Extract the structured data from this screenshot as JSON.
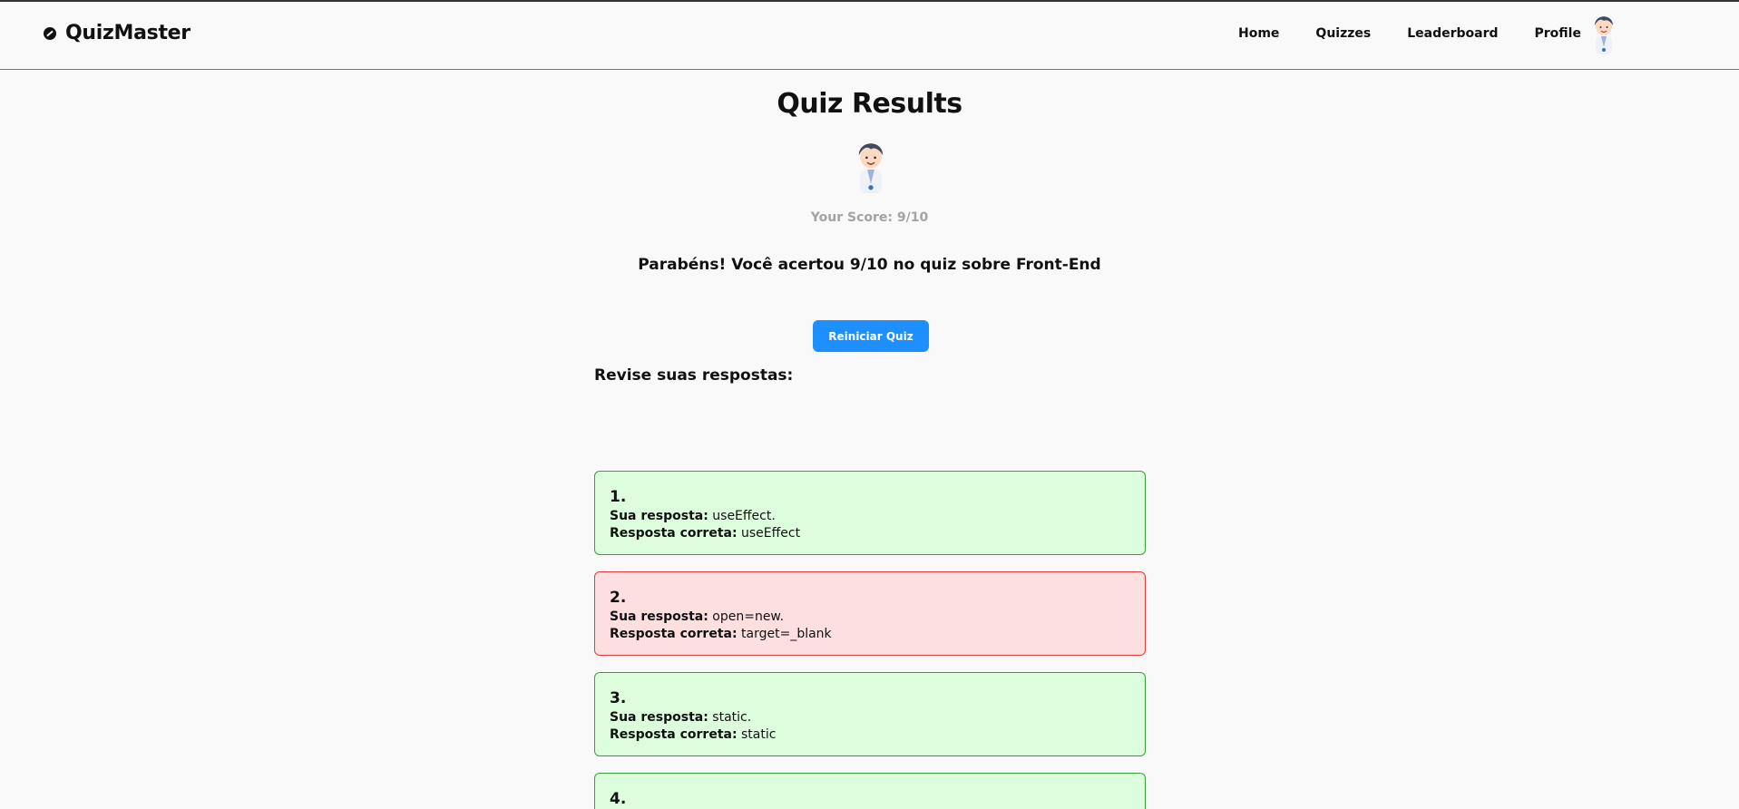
{
  "navbar": {
    "brand": "QuizMaster",
    "links": [
      "Home",
      "Quizzes",
      "Leaderboard",
      "Profile"
    ]
  },
  "results": {
    "title": "Quiz Results",
    "score_text": "Your Score: 9/10",
    "message": "Parabéns! Você acertou 9/10 no quiz sobre Front-End",
    "restart_label": "Reiniciar Quiz",
    "review_heading": "Revise suas respostas:"
  },
  "labels": {
    "your_answer": "Sua resposta:",
    "correct_answer": "Resposta correta:"
  },
  "answers": [
    {
      "number": "1.",
      "your_answer": "useEffect.",
      "correct_answer": "useEffect",
      "status": "correct"
    },
    {
      "number": "2.",
      "your_answer": "open=new.",
      "correct_answer": "target=_blank",
      "status": "wrong"
    },
    {
      "number": "3.",
      "your_answer": "static.",
      "correct_answer": "static",
      "status": "correct"
    },
    {
      "number": "4.",
      "your_answer": "",
      "correct_answer": "",
      "status": "correct"
    }
  ],
  "colors": {
    "accent": "#1e8fff",
    "correct_bg": "#ddfedd",
    "correct_border": "#3aa13a",
    "wrong_bg": "#fedfe0",
    "wrong_border": "#e43b3b",
    "score_text": "#a3a3a3"
  },
  "icons": {
    "brand": "compass-icon",
    "avatar": "doctor-avatar"
  }
}
